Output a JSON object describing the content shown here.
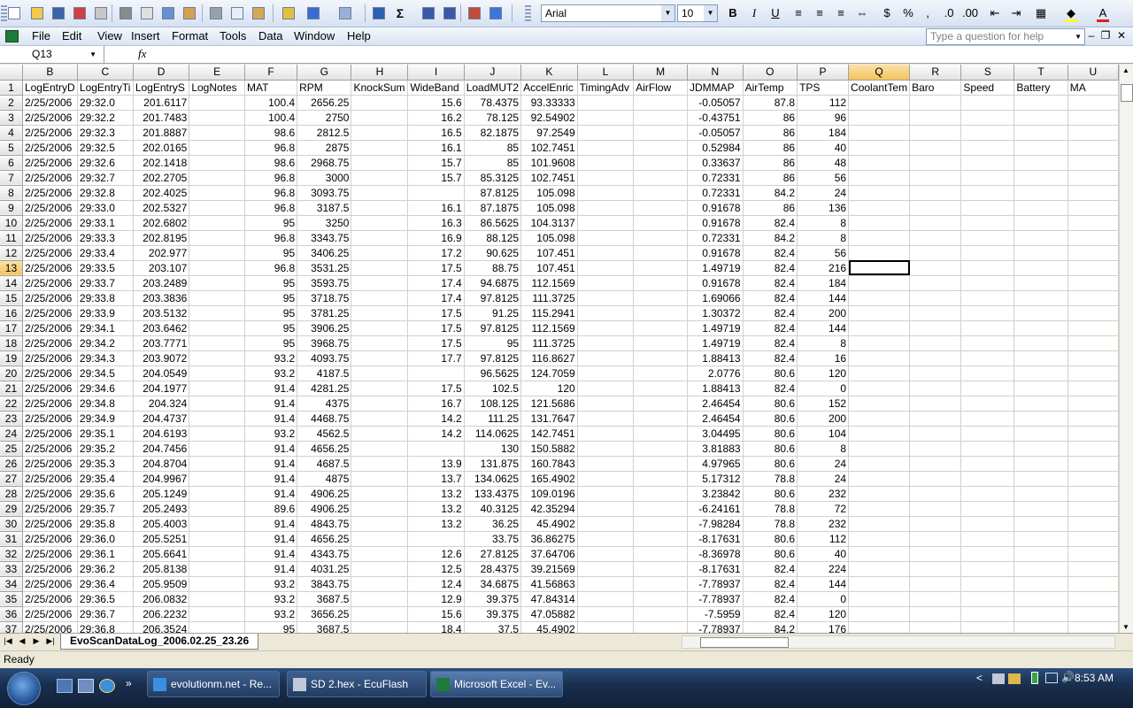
{
  "toolbar": {
    "font_name": "Arial",
    "font_size": "10"
  },
  "menu": {
    "items": [
      "File",
      "Edit",
      "View",
      "Insert",
      "Format",
      "Tools",
      "Data",
      "Window",
      "Help"
    ],
    "help_placeholder": "Type a question for help"
  },
  "formula": {
    "cell_ref": "Q13",
    "fx": "fx",
    "content": ""
  },
  "sheet": {
    "col_letters": [
      "B",
      "C",
      "D",
      "E",
      "F",
      "G",
      "H",
      "I",
      "J",
      "K",
      "L",
      "M",
      "N",
      "O",
      "P",
      "Q",
      "R",
      "S",
      "T",
      "U"
    ],
    "selected_col": "Q",
    "selected_row": 13,
    "headers": [
      "LogEntryD",
      "LogEntryTi",
      "LogEntryS",
      "LogNotes",
      "MAT",
      "RPM",
      "KnockSum",
      "WideBand",
      "LoadMUT2",
      "AccelEnric",
      "TimingAdv",
      "AirFlow",
      "JDMMAP",
      "AirTemp",
      "TPS",
      "CoolantTem",
      "Baro",
      "Speed",
      "Battery",
      "MA"
    ],
    "rows": [
      [
        "2/25/2006",
        "29:32.0",
        "201.6117",
        "",
        "100.4",
        "2656.25",
        "",
        "15.6",
        "78.4375",
        "93.33333",
        "",
        "",
        "-0.05057",
        "87.8",
        "112"
      ],
      [
        "2/25/2006",
        "29:32.2",
        "201.7483",
        "",
        "100.4",
        "2750",
        "",
        "16.2",
        "78.125",
        "92.54902",
        "",
        "",
        "-0.43751",
        "86",
        "96"
      ],
      [
        "2/25/2006",
        "29:32.3",
        "201.8887",
        "",
        "98.6",
        "2812.5",
        "",
        "16.5",
        "82.1875",
        "97.2549",
        "",
        "",
        "-0.05057",
        "86",
        "184"
      ],
      [
        "2/25/2006",
        "29:32.5",
        "202.0165",
        "",
        "96.8",
        "2875",
        "",
        "16.1",
        "85",
        "102.7451",
        "",
        "",
        "0.52984",
        "86",
        "40"
      ],
      [
        "2/25/2006",
        "29:32.6",
        "202.1418",
        "",
        "98.6",
        "2968.75",
        "",
        "15.7",
        "85",
        "101.9608",
        "",
        "",
        "0.33637",
        "86",
        "48"
      ],
      [
        "2/25/2006",
        "29:32.7",
        "202.2705",
        "",
        "96.8",
        "3000",
        "",
        "15.7",
        "85.3125",
        "102.7451",
        "",
        "",
        "0.72331",
        "86",
        "56"
      ],
      [
        "2/25/2006",
        "29:32.8",
        "202.4025",
        "",
        "96.8",
        "3093.75",
        "",
        "",
        "87.8125",
        "105.098",
        "",
        "",
        "0.72331",
        "84.2",
        "24"
      ],
      [
        "2/25/2006",
        "29:33.0",
        "202.5327",
        "",
        "96.8",
        "3187.5",
        "",
        "16.1",
        "87.1875",
        "105.098",
        "",
        "",
        "0.91678",
        "86",
        "136"
      ],
      [
        "2/25/2006",
        "29:33.1",
        "202.6802",
        "",
        "95",
        "3250",
        "",
        "16.3",
        "86.5625",
        "104.3137",
        "",
        "",
        "0.91678",
        "82.4",
        "8"
      ],
      [
        "2/25/2006",
        "29:33.3",
        "202.8195",
        "",
        "96.8",
        "3343.75",
        "",
        "16.9",
        "88.125",
        "105.098",
        "",
        "",
        "0.72331",
        "84.2",
        "8"
      ],
      [
        "2/25/2006",
        "29:33.4",
        "202.977",
        "",
        "95",
        "3406.25",
        "",
        "17.2",
        "90.625",
        "107.451",
        "",
        "",
        "0.91678",
        "82.4",
        "56"
      ],
      [
        "2/25/2006",
        "29:33.5",
        "203.107",
        "",
        "96.8",
        "3531.25",
        "",
        "17.5",
        "88.75",
        "107.451",
        "",
        "",
        "1.49719",
        "82.4",
        "216"
      ],
      [
        "2/25/2006",
        "29:33.7",
        "203.2489",
        "",
        "95",
        "3593.75",
        "",
        "17.4",
        "94.6875",
        "112.1569",
        "",
        "",
        "0.91678",
        "82.4",
        "184"
      ],
      [
        "2/25/2006",
        "29:33.8",
        "203.3836",
        "",
        "95",
        "3718.75",
        "",
        "17.4",
        "97.8125",
        "111.3725",
        "",
        "",
        "1.69066",
        "82.4",
        "144"
      ],
      [
        "2/25/2006",
        "29:33.9",
        "203.5132",
        "",
        "95",
        "3781.25",
        "",
        "17.5",
        "91.25",
        "115.2941",
        "",
        "",
        "1.30372",
        "82.4",
        "200"
      ],
      [
        "2/25/2006",
        "29:34.1",
        "203.6462",
        "",
        "95",
        "3906.25",
        "",
        "17.5",
        "97.8125",
        "112.1569",
        "",
        "",
        "1.49719",
        "82.4",
        "144"
      ],
      [
        "2/25/2006",
        "29:34.2",
        "203.7771",
        "",
        "95",
        "3968.75",
        "",
        "17.5",
        "95",
        "111.3725",
        "",
        "",
        "1.49719",
        "82.4",
        "8"
      ],
      [
        "2/25/2006",
        "29:34.3",
        "203.9072",
        "",
        "93.2",
        "4093.75",
        "",
        "17.7",
        "97.8125",
        "116.8627",
        "",
        "",
        "1.88413",
        "82.4",
        "16"
      ],
      [
        "2/25/2006",
        "29:34.5",
        "204.0549",
        "",
        "93.2",
        "4187.5",
        "",
        "",
        "96.5625",
        "124.7059",
        "",
        "",
        "2.0776",
        "80.6",
        "120"
      ],
      [
        "2/25/2006",
        "29:34.6",
        "204.1977",
        "",
        "91.4",
        "4281.25",
        "",
        "17.5",
        "102.5",
        "120",
        "",
        "",
        "1.88413",
        "82.4",
        "0"
      ],
      [
        "2/25/2006",
        "29:34.8",
        "204.324",
        "",
        "91.4",
        "4375",
        "",
        "16.7",
        "108.125",
        "121.5686",
        "",
        "",
        "2.46454",
        "80.6",
        "152"
      ],
      [
        "2/25/2006",
        "29:34.9",
        "204.4737",
        "",
        "91.4",
        "4468.75",
        "",
        "14.2",
        "111.25",
        "131.7647",
        "",
        "",
        "2.46454",
        "80.6",
        "200"
      ],
      [
        "2/25/2006",
        "29:35.1",
        "204.6193",
        "",
        "93.2",
        "4562.5",
        "",
        "14.2",
        "114.0625",
        "142.7451",
        "",
        "",
        "3.04495",
        "80.6",
        "104"
      ],
      [
        "2/25/2006",
        "29:35.2",
        "204.7456",
        "",
        "91.4",
        "4656.25",
        "",
        "",
        "130",
        "150.5882",
        "",
        "",
        "3.81883",
        "80.6",
        "8"
      ],
      [
        "2/25/2006",
        "29:35.3",
        "204.8704",
        "",
        "91.4",
        "4687.5",
        "",
        "13.9",
        "131.875",
        "160.7843",
        "",
        "",
        "4.97965",
        "80.6",
        "24"
      ],
      [
        "2/25/2006",
        "29:35.4",
        "204.9967",
        "",
        "91.4",
        "4875",
        "",
        "13.7",
        "134.0625",
        "165.4902",
        "",
        "",
        "5.17312",
        "78.8",
        "24"
      ],
      [
        "2/25/2006",
        "29:35.6",
        "205.1249",
        "",
        "91.4",
        "4906.25",
        "",
        "13.2",
        "133.4375",
        "109.0196",
        "",
        "",
        "3.23842",
        "80.6",
        "232"
      ],
      [
        "2/25/2006",
        "29:35.7",
        "205.2493",
        "",
        "89.6",
        "4906.25",
        "",
        "13.2",
        "40.3125",
        "42.35294",
        "",
        "",
        "-6.24161",
        "78.8",
        "72"
      ],
      [
        "2/25/2006",
        "29:35.8",
        "205.4003",
        "",
        "91.4",
        "4843.75",
        "",
        "13.2",
        "36.25",
        "45.4902",
        "",
        "",
        "-7.98284",
        "78.8",
        "232"
      ],
      [
        "2/25/2006",
        "29:36.0",
        "205.5251",
        "",
        "91.4",
        "4656.25",
        "",
        "",
        "33.75",
        "36.86275",
        "",
        "",
        "-8.17631",
        "80.6",
        "112"
      ],
      [
        "2/25/2006",
        "29:36.1",
        "205.6641",
        "",
        "91.4",
        "4343.75",
        "",
        "12.6",
        "27.8125",
        "37.64706",
        "",
        "",
        "-8.36978",
        "80.6",
        "40"
      ],
      [
        "2/25/2006",
        "29:36.2",
        "205.8138",
        "",
        "91.4",
        "4031.25",
        "",
        "12.5",
        "28.4375",
        "39.21569",
        "",
        "",
        "-8.17631",
        "82.4",
        "224"
      ],
      [
        "2/25/2006",
        "29:36.4",
        "205.9509",
        "",
        "93.2",
        "3843.75",
        "",
        "12.4",
        "34.6875",
        "41.56863",
        "",
        "",
        "-7.78937",
        "82.4",
        "144"
      ],
      [
        "2/25/2006",
        "29:36.5",
        "206.0832",
        "",
        "93.2",
        "3687.5",
        "",
        "12.9",
        "39.375",
        "47.84314",
        "",
        "",
        "-7.78937",
        "82.4",
        "0"
      ],
      [
        "2/25/2006",
        "29:36.7",
        "206.2232",
        "",
        "93.2",
        "3656.25",
        "",
        "15.6",
        "39.375",
        "47.05882",
        "",
        "",
        "-7.5959",
        "82.4",
        "120"
      ],
      [
        "2/25/2006",
        "29:36.8",
        "206.3524",
        "",
        "95",
        "3687.5",
        "",
        "18.4",
        "37.5",
        "45.4902",
        "",
        "",
        "-7.78937",
        "84.2",
        "176"
      ]
    ]
  },
  "sheet_tab": "EvoScanDataLog_2006.02.25_23.26",
  "status": "Ready",
  "taskbar": {
    "buttons": [
      "evolutionm.net - Re...",
      "SD 2.hex - EcuFlash",
      "Microsoft Excel - Ev..."
    ],
    "clock": "8:53 AM"
  }
}
